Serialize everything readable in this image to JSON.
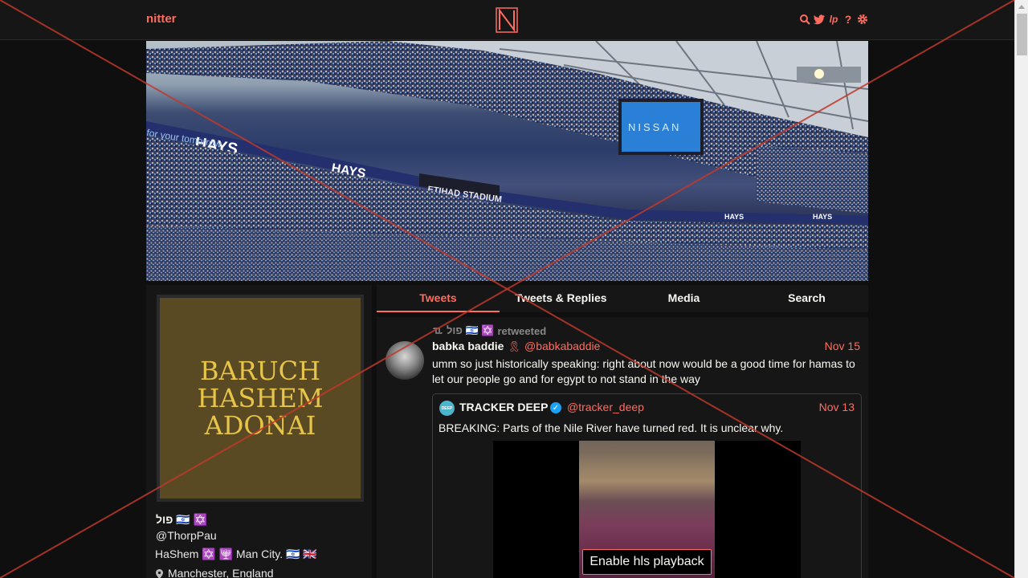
{
  "nav": {
    "brand": "nitter",
    "logo_letter": "N",
    "icons": [
      "search-icon",
      "twitter-bird-icon",
      "lp-icon",
      "help-icon",
      "gear-icon"
    ],
    "lp_label": "lp",
    "help_label": "?"
  },
  "banner": {
    "board_text": "NISSAN",
    "stadium_sign": "ETIHAD STADIUM",
    "ad_text": "HAYS",
    "ad_slogan": "for your tomorrow"
  },
  "profile": {
    "avatar_lines": [
      "BARUCH",
      "HASHEM",
      "ADONAI"
    ],
    "name": "פול 🇮🇱 ✡️",
    "handle": "@ThorpPau",
    "bio": "HaShem ✡️ 🕎  Man City. 🇮🇱 🇬🇧",
    "location": "Manchester, England"
  },
  "tabs": [
    {
      "label": "Tweets",
      "active": true
    },
    {
      "label": "Tweets & Replies",
      "active": false
    },
    {
      "label": "Media",
      "active": false
    },
    {
      "label": "Search",
      "active": false
    }
  ],
  "tweet": {
    "retweet_by": "פול 🇮🇱 ✡️",
    "retweet_label": "retweeted",
    "fullname": "babka baddie",
    "username": "@babkabaddie",
    "date": "Nov 15",
    "text": "umm so just historically speaking: right about now would be a good time for hamas to let our people go and for egypt to not stand in the way",
    "quote": {
      "avatar_label": "DEEP",
      "fullname": "TRACKER DEEP",
      "username": "@tracker_deep",
      "date": "Nov 13",
      "text": "BREAKING: Parts of the Nile River have turned red. It is unclear why.",
      "media_button": "Enable hls playback"
    }
  },
  "colors": {
    "accent": "#ff6c60",
    "background": "#0f0f0f",
    "panel": "#161616",
    "overlay": "#c0392b"
  }
}
